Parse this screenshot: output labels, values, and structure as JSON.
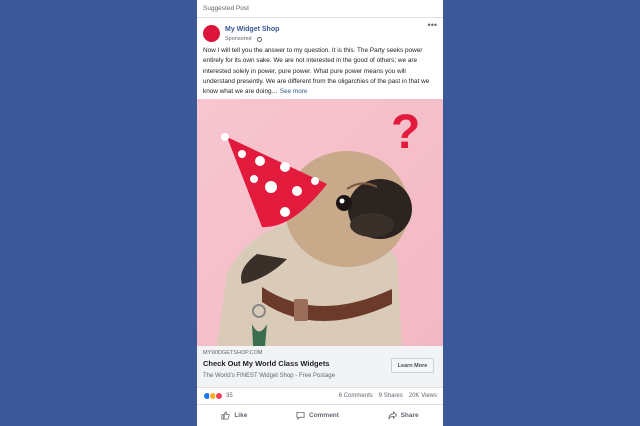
{
  "post": {
    "suggested_label": "Suggested Post",
    "page_name": "My Widget Shop",
    "sponsored_label": "Sponsored · ",
    "more_icon": "•••",
    "body_text": "Now I will tell you the answer to my question. It is this. The Party seeks power entirely for its own sake. We are not interested in the good of others; we are interested solely in power, pure power. What pure power means you will understand presently. We are different from the oligarchies of the past in that we know what we are doing… ",
    "see_more": "See more",
    "image_alt": "Pug wearing a red polka-dot party hat with a question mark",
    "question_mark": "?"
  },
  "link": {
    "domain": "MYWIDGETSHOP.COM",
    "headline": "Check Out My World Class Widgets",
    "description": "The World's FINEST Widget Shop - Free Postage",
    "cta": "Learn More"
  },
  "stats": {
    "reaction_count": "35",
    "comments": "6 Comments",
    "shares": "9 Shares",
    "views": "20K Views"
  },
  "actions": {
    "like": "Like",
    "comment": "Comment",
    "share": "Share"
  },
  "colors": {
    "background": "#3b5998",
    "avatar": "#dc143c",
    "link_blue": "#385898",
    "image_bg": "#f7c6cf"
  }
}
